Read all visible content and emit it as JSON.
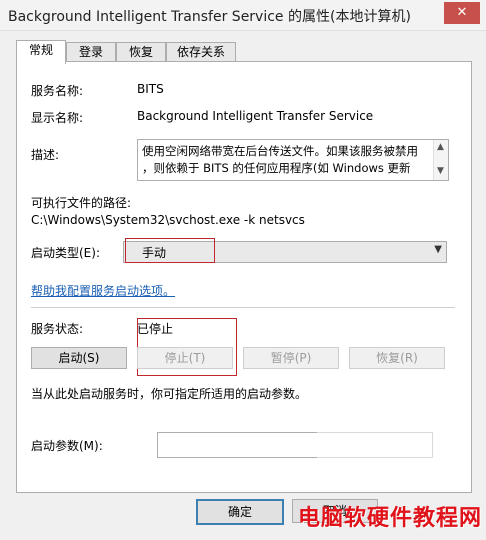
{
  "window": {
    "title": "Background Intelligent Transfer Service 的属性(本地计算机)",
    "close_icon": "✕"
  },
  "tabs": [
    {
      "label": "常规"
    },
    {
      "label": "登录"
    },
    {
      "label": "恢复"
    },
    {
      "label": "依存关系"
    }
  ],
  "general": {
    "service_name_label": "服务名称:",
    "service_name_value": "BITS",
    "display_name_label": "显示名称:",
    "display_name_value": "Background Intelligent Transfer Service",
    "description_label": "描述:",
    "description_lines": [
      "使用空闲网络带宽在后台传送文件。如果该服务被禁用",
      "，则依赖于 BITS 的任何应用程序(如 Windows 更新"
    ],
    "exec_path_label": "可执行文件的路径:",
    "exec_path_value": "C:\\Windows\\System32\\svchost.exe -k netsvcs",
    "startup_type_label": "启动类型(E):",
    "startup_type_value": "手动",
    "help_link": "帮助我配置服务启动选项。",
    "status_label": "服务状态:",
    "status_value": "已停止",
    "buttons": {
      "start": "启动(S)",
      "stop": "停止(T)",
      "pause": "暂停(P)",
      "resume": "恢复(R)"
    },
    "hint_text": "当从此处启动服务时，你可指定所适用的启动参数。",
    "params_label": "启动参数(M):",
    "params_value": ""
  },
  "footer": {
    "ok_label": "确定",
    "cancel_label": "取消"
  },
  "watermark": "电脑软硬件教程网",
  "colors": {
    "highlight_box": "#c0282e",
    "link": "#1a5fb4",
    "watermark": "#e0121a"
  }
}
